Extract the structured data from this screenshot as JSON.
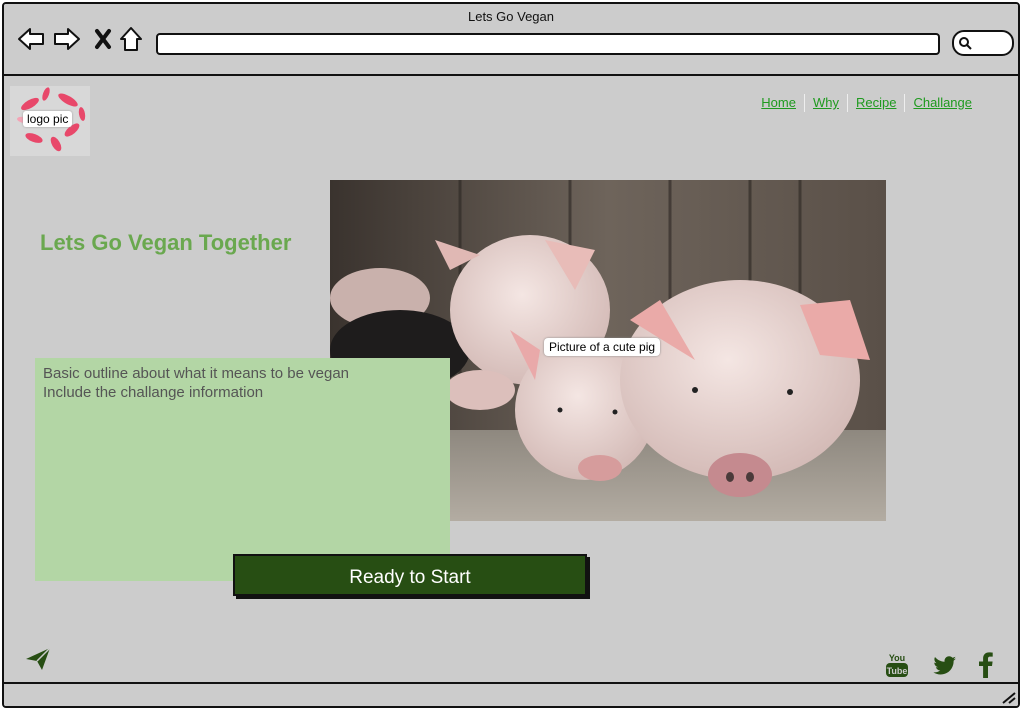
{
  "window": {
    "title": "Lets Go Vegan"
  },
  "browser": {
    "back_icon": "back-arrow-icon",
    "forward_icon": "forward-arrow-icon",
    "close_icon": "x-close-icon",
    "home_icon": "home-icon",
    "search_icon": "search-icon"
  },
  "header": {
    "logo_label": "logo pic",
    "nav": [
      {
        "label": "Home"
      },
      {
        "label": "Why"
      },
      {
        "label": "Recipe"
      },
      {
        "label": "Challange"
      }
    ]
  },
  "main": {
    "headline": "Lets Go Vegan Together",
    "hero_label": "Picture of a cute pig",
    "info_lines": [
      "Basic outline about what it means to be vegan",
      "Include the challange information"
    ],
    "cta_label": "Ready to Start"
  },
  "footer": {
    "icons": [
      "send-icon",
      "youtube-icon",
      "twitter-icon",
      "facebook-icon"
    ],
    "youtube_text_top": "You",
    "youtube_text_bottom": "Tube"
  },
  "colors": {
    "background": "#cccccc",
    "link": "#1f9a1f",
    "headline": "#6aa84f",
    "infobox": "#b3d6a5",
    "button": "#274e13",
    "icon": "#274e13"
  }
}
